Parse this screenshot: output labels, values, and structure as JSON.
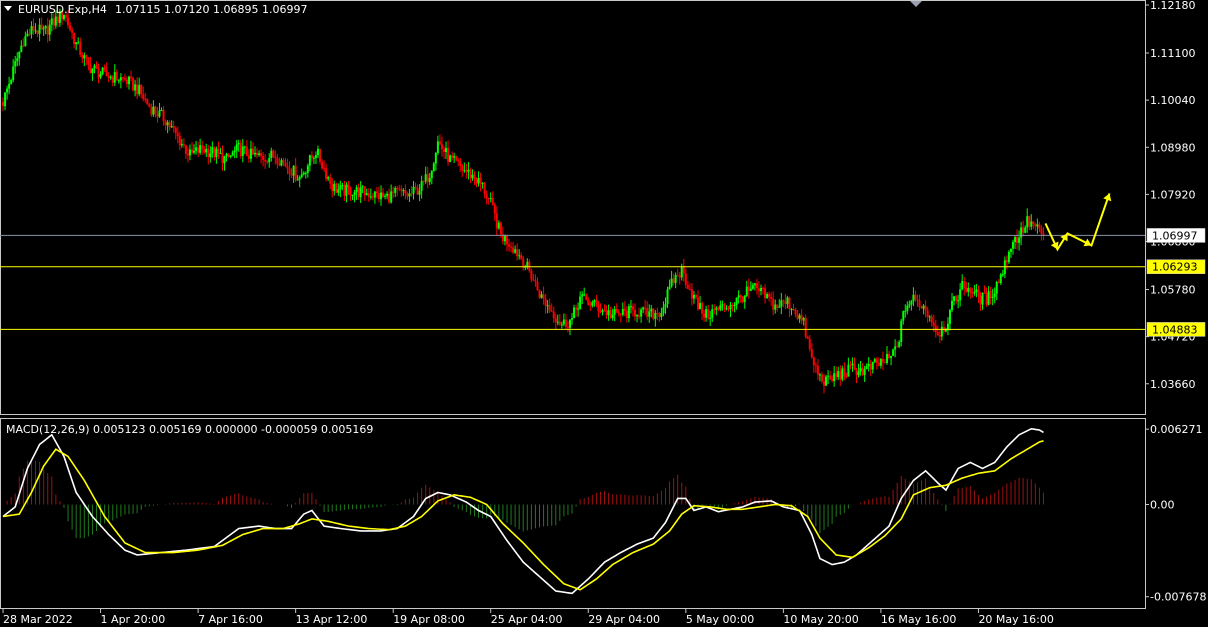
{
  "header": {
    "symbol": "EURUSD.Exp,H4",
    "ohlc": "1.07115 1.07120 1.06895 1.06997"
  },
  "macd_header": {
    "label": "MACD(12,26,9) 0.005123 0.005169 0.000000 -0.000059 0.005169"
  },
  "colors": {
    "background": "#000000",
    "bull_candle": "#00ff00",
    "bear_candle": "#ff0000",
    "level_line": "#ffff00",
    "bid_line": "#8a93a6",
    "macd_line": "#ffffff",
    "signal_line": "#ffff00",
    "hist_positive": "#a01010",
    "hist_negative": "#1f7a1f",
    "arrow": "#ffff00"
  },
  "chart_data": [
    {
      "type": "candlestick",
      "title": "EURUSD.Exp,H4",
      "ylim": [
        1.0334,
        1.1218
      ],
      "y_ticks": [
        "1.12180",
        "1.11100",
        "1.10040",
        "1.08980",
        "1.07920",
        "1.06860",
        "1.05780",
        "1.04720",
        "1.03660"
      ],
      "x_labels": [
        "28 Mar 2022",
        "1 Apr 20:00",
        "7 Apr 16:00",
        "13 Apr 12:00",
        "19 Apr 08:00",
        "25 Apr 04:00",
        "29 Apr 04:00",
        "5 May 00:00",
        "10 May 20:00",
        "16 May 16:00",
        "20 May 16:00"
      ],
      "current_price": "1.06997",
      "levels": [
        "1.06293",
        "1.04883"
      ],
      "close_path": [
        [
          0,
          1.1
        ],
        [
          5,
          1.107
        ],
        [
          10,
          1.114
        ],
        [
          15,
          1.1165
        ],
        [
          20,
          1.1155
        ],
        [
          25,
          1.118
        ],
        [
          30,
          1.12
        ],
        [
          36,
          1.113
        ],
        [
          42,
          1.108
        ],
        [
          50,
          1.106
        ],
        [
          60,
          1.105
        ],
        [
          66,
          1.103
        ],
        [
          72,
          1.099
        ],
        [
          80,
          1.096
        ],
        [
          86,
          1.092
        ],
        [
          92,
          1.088
        ],
        [
          98,
          1.0895
        ],
        [
          104,
          1.0885
        ],
        [
          110,
          1.087
        ],
        [
          116,
          1.0895
        ],
        [
          122,
          1.088
        ],
        [
          128,
          1.0875
        ],
        [
          134,
          1.088
        ],
        [
          140,
          1.0855
        ],
        [
          146,
          1.083
        ],
        [
          150,
          1.086
        ],
        [
          154,
          1.089
        ],
        [
          158,
          1.085
        ],
        [
          162,
          1.081
        ],
        [
          166,
          1.08
        ],
        [
          172,
          1.08
        ],
        [
          180,
          1.0795
        ],
        [
          188,
          1.0785
        ],
        [
          194,
          1.0795
        ],
        [
          200,
          1.079
        ],
        [
          206,
          1.081
        ],
        [
          210,
          1.084
        ],
        [
          214,
          1.091
        ],
        [
          220,
          1.087
        ],
        [
          226,
          1.085
        ],
        [
          232,
          1.083
        ],
        [
          236,
          1.081
        ],
        [
          240,
          1.077
        ],
        [
          245,
          1.07
        ],
        [
          250,
          1.068
        ],
        [
          255,
          1.065
        ],
        [
          260,
          1.061
        ],
        [
          265,
          1.056
        ],
        [
          270,
          1.053
        ],
        [
          275,
          1.05
        ],
        [
          280,
          1.051
        ],
        [
          284,
          1.056
        ],
        [
          290,
          1.0545
        ],
        [
          296,
          1.053
        ],
        [
          300,
          1.052
        ],
        [
          306,
          1.0525
        ],
        [
          312,
          1.053
        ],
        [
          318,
          1.052
        ],
        [
          324,
          1.053
        ],
        [
          330,
          1.06
        ],
        [
          334,
          1.062
        ],
        [
          338,
          1.058
        ],
        [
          342,
          1.054
        ],
        [
          346,
          1.052
        ],
        [
          350,
          1.053
        ],
        [
          356,
          1.054
        ],
        [
          360,
          1.055
        ],
        [
          366,
          1.057
        ],
        [
          370,
          1.058
        ],
        [
          376,
          1.056
        ],
        [
          380,
          1.054
        ],
        [
          386,
          1.055
        ],
        [
          390,
          1.053
        ],
        [
          394,
          1.05
        ],
        [
          398,
          1.042
        ],
        [
          402,
          1.038
        ],
        [
          406,
          1.037
        ],
        [
          410,
          1.0385
        ],
        [
          414,
          1.039
        ],
        [
          418,
          1.04
        ],
        [
          424,
          1.0395
        ],
        [
          430,
          1.041
        ],
        [
          436,
          1.042
        ],
        [
          440,
          1.045
        ],
        [
          444,
          1.054
        ],
        [
          448,
          1.0555
        ],
        [
          452,
          1.0545
        ],
        [
          456,
          1.052
        ],
        [
          460,
          1.048
        ],
        [
          464,
          1.05
        ],
        [
          468,
          1.055
        ],
        [
          472,
          1.0585
        ],
        [
          476,
          1.058
        ],
        [
          480,
          1.056
        ],
        [
          484,
          1.0555
        ],
        [
          488,
          1.058
        ],
        [
          492,
          1.062
        ],
        [
          496,
          1.068
        ],
        [
          500,
          1.07
        ],
        [
          504,
          1.073
        ],
        [
          508,
          1.072
        ],
        [
          510,
          1.0705
        ],
        [
          512,
          1.07
        ]
      ]
    },
    {
      "type": "line",
      "title": "MACD(12,26,9)",
      "ylim": [
        -0.00795,
        0.00645
      ],
      "y_ticks": [
        "0.006271",
        "0.00",
        "-0.007678"
      ],
      "series": [
        {
          "name": "MACD",
          "points": [
            [
              0,
              -0.001
            ],
            [
              6,
              -0.0002
            ],
            [
              12,
              0.003
            ],
            [
              18,
              0.005
            ],
            [
              24,
              0.0058
            ],
            [
              30,
              0.004
            ],
            [
              36,
              0.001
            ],
            [
              44,
              -0.001
            ],
            [
              52,
              -0.0025
            ],
            [
              60,
              -0.0038
            ],
            [
              66,
              -0.0042
            ],
            [
              78,
              -0.004
            ],
            [
              90,
              -0.0038
            ],
            [
              104,
              -0.0035
            ],
            [
              116,
              -0.002
            ],
            [
              126,
              -0.0018
            ],
            [
              134,
              -0.002
            ],
            [
              142,
              -0.002
            ],
            [
              148,
              -0.0008
            ],
            [
              152,
              -0.0005
            ],
            [
              158,
              -0.0018
            ],
            [
              166,
              -0.002
            ],
            [
              176,
              -0.0022
            ],
            [
              186,
              -0.0022
            ],
            [
              194,
              -0.002
            ],
            [
              202,
              -0.001
            ],
            [
              208,
              0.0005
            ],
            [
              214,
              0.001
            ],
            [
              220,
              0.0008
            ],
            [
              228,
              0.0002
            ],
            [
              234,
              -0.0005
            ],
            [
              240,
              -0.001
            ],
            [
              248,
              -0.003
            ],
            [
              256,
              -0.0048
            ],
            [
              264,
              -0.006
            ],
            [
              272,
              -0.0072
            ],
            [
              280,
              -0.0074
            ],
            [
              288,
              -0.0062
            ],
            [
              296,
              -0.0048
            ],
            [
              304,
              -0.004
            ],
            [
              312,
              -0.0033
            ],
            [
              320,
              -0.0028
            ],
            [
              326,
              -0.0015
            ],
            [
              332,
              0.0005
            ],
            [
              336,
              0.0005
            ],
            [
              340,
              -0.0005
            ],
            [
              346,
              -0.0002
            ],
            [
              352,
              -0.0006
            ],
            [
              358,
              -0.0004
            ],
            [
              364,
              -0.0002
            ],
            [
              370,
              0.0002
            ],
            [
              378,
              0.0003
            ],
            [
              384,
              -0.0002
            ],
            [
              392,
              -0.0005
            ],
            [
              398,
              -0.0025
            ],
            [
              402,
              -0.0045
            ],
            [
              408,
              -0.005
            ],
            [
              414,
              -0.0048
            ],
            [
              420,
              -0.0042
            ],
            [
              428,
              -0.003
            ],
            [
              436,
              -0.0018
            ],
            [
              442,
              0.0005
            ],
            [
              448,
              0.002
            ],
            [
              454,
              0.0028
            ],
            [
              460,
              0.0018
            ],
            [
              464,
              0.0012
            ],
            [
              470,
              0.003
            ],
            [
              476,
              0.0035
            ],
            [
              482,
              0.003
            ],
            [
              488,
              0.0035
            ],
            [
              494,
              0.0048
            ],
            [
              500,
              0.0058
            ],
            [
              506,
              0.0063
            ],
            [
              510,
              0.0062
            ],
            [
              512,
              0.006
            ]
          ]
        },
        {
          "name": "Signal",
          "points": [
            [
              0,
              -0.001
            ],
            [
              8,
              -0.0008
            ],
            [
              14,
              0.001
            ],
            [
              20,
              0.0032
            ],
            [
              26,
              0.0046
            ],
            [
              32,
              0.004
            ],
            [
              40,
              0.002
            ],
            [
              50,
              -0.001
            ],
            [
              60,
              -0.0032
            ],
            [
              70,
              -0.004
            ],
            [
              84,
              -0.004
            ],
            [
              96,
              -0.0038
            ],
            [
              108,
              -0.0034
            ],
            [
              118,
              -0.0025
            ],
            [
              128,
              -0.002
            ],
            [
              138,
              -0.002
            ],
            [
              146,
              -0.0016
            ],
            [
              152,
              -0.0012
            ],
            [
              160,
              -0.0014
            ],
            [
              170,
              -0.0018
            ],
            [
              180,
              -0.002
            ],
            [
              190,
              -0.0021
            ],
            [
              198,
              -0.0018
            ],
            [
              206,
              -0.001
            ],
            [
              214,
              0.0003
            ],
            [
              222,
              0.0008
            ],
            [
              230,
              0.0006
            ],
            [
              238,
              0.0
            ],
            [
              246,
              -0.0016
            ],
            [
              256,
              -0.0032
            ],
            [
              266,
              -0.005
            ],
            [
              276,
              -0.0066
            ],
            [
              284,
              -0.0071
            ],
            [
              292,
              -0.0062
            ],
            [
              300,
              -0.005
            ],
            [
              310,
              -0.004
            ],
            [
              320,
              -0.0033
            ],
            [
              328,
              -0.0022
            ],
            [
              334,
              -0.0008
            ],
            [
              340,
              -0.0001
            ],
            [
              348,
              -0.0002
            ],
            [
              356,
              -0.0004
            ],
            [
              364,
              -0.0004
            ],
            [
              372,
              -0.0002
            ],
            [
              380,
              0.0
            ],
            [
              388,
              -0.0001
            ],
            [
              396,
              -0.001
            ],
            [
              402,
              -0.0028
            ],
            [
              410,
              -0.0042
            ],
            [
              418,
              -0.0044
            ],
            [
              426,
              -0.0036
            ],
            [
              434,
              -0.0026
            ],
            [
              442,
              -0.0012
            ],
            [
              448,
              0.0008
            ],
            [
              456,
              0.0014
            ],
            [
              464,
              0.0016
            ],
            [
              472,
              0.0022
            ],
            [
              480,
              0.0026
            ],
            [
              488,
              0.0028
            ],
            [
              496,
              0.0038
            ],
            [
              504,
              0.0046
            ],
            [
              510,
              0.0052
            ],
            [
              512,
              0.0053
            ]
          ]
        }
      ]
    }
  ]
}
